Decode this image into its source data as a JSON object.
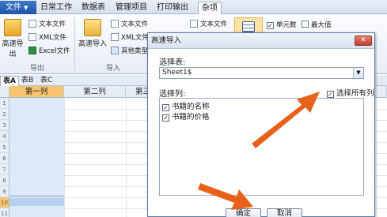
{
  "tabs": {
    "file": "文件",
    "daily": "日常工作",
    "data_table": "数据表",
    "manage": "管理项目",
    "print": "打印输出",
    "misc": "杂项"
  },
  "ribbon": {
    "export_fast": "高速导出",
    "text_file": "文本文件",
    "xml_file": "XML文件",
    "excel_file": "Excel文件",
    "export_group": "导出",
    "import_fast": "高速导入",
    "text_file2": "文本文件",
    "xml_file2": "XML文件",
    "other_types": "其他类型",
    "import_group": "导入",
    "text_file3": "文本文件",
    "unit_count": "单元数",
    "max_value": "最大值"
  },
  "sheets": [
    "表A",
    "表B",
    "表C"
  ],
  "grid": {
    "col1": "第一列",
    "col2": "第二列",
    "col3": "第三"
  },
  "dialog": {
    "title": "高速导入",
    "close": "✕",
    "select_table_label": "选择表:",
    "table_value": "Sheet1$",
    "select_columns_label": "选择列:",
    "select_all": "选择所有列",
    "columns": [
      "书籍的名称",
      "书籍的价格"
    ],
    "ok": "确定",
    "cancel": "取消"
  },
  "colors": {
    "arrow": "#e8611a",
    "accent": "#2a62b4"
  }
}
